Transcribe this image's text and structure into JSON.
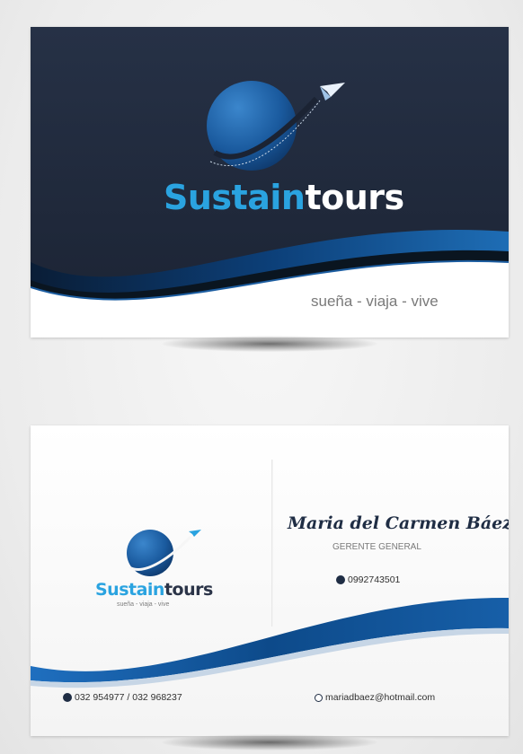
{
  "front": {
    "brand_part1": "Sustain",
    "brand_part2": "tours",
    "tagline": "sueña - viaja - vive"
  },
  "back": {
    "brand_part1": "Sustain",
    "brand_part2": "tours",
    "tagline": "sueña - viaja - vive",
    "name": "Maria del Carmen Báez",
    "role": "GERENTE GENERAL",
    "mobile": "0992743501",
    "phone": "032 954977 / 032 968237",
    "email": "mariadbaez@hotmail.com"
  },
  "colors": {
    "navy": "#1f2a3c",
    "brand_blue": "#2aa3e0",
    "deep_blue": "#0b3e74"
  },
  "icons": {
    "logo": "globe-with-paper-plane-icon",
    "mobile": "mobile-phone-icon",
    "phone": "telephone-icon",
    "email": "at-sign-icon"
  }
}
